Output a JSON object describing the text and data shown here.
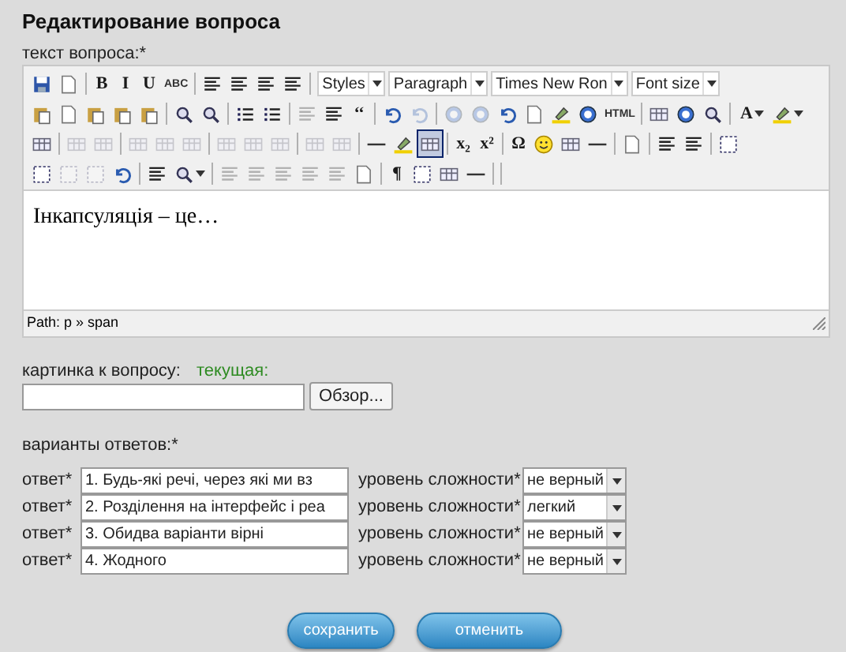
{
  "heading": "Редактирование вопроса",
  "question_label": "текст вопроса:*",
  "toolbar_rows": [
    [
      {
        "kind": "button",
        "disabled": false,
        "active": false
      },
      {
        "kind": "button",
        "disabled": false,
        "active": false
      },
      {
        "kind": "separator"
      },
      {
        "kind": "button",
        "label": "B",
        "disabled": false,
        "active": false
      },
      {
        "kind": "button",
        "label": "I",
        "disabled": false,
        "active": false
      },
      {
        "kind": "button",
        "label": "U",
        "disabled": false,
        "active": false
      },
      {
        "kind": "button",
        "label": "ABC",
        "disabled": false,
        "active": false
      },
      {
        "kind": "separator"
      },
      {
        "kind": "button",
        "disabled": false,
        "active": false
      },
      {
        "kind": "button",
        "disabled": false,
        "active": false
      },
      {
        "kind": "button",
        "disabled": false,
        "active": false
      },
      {
        "kind": "button",
        "disabled": false,
        "active": false
      },
      {
        "kind": "separator"
      },
      {
        "kind": "select",
        "value": "Styles"
      },
      {
        "kind": "select",
        "value": "Paragraph"
      },
      {
        "kind": "select",
        "value": "Times New Ron"
      },
      {
        "kind": "select",
        "value": "Font size"
      }
    ],
    [
      {
        "kind": "button",
        "disabled": false,
        "active": false
      },
      {
        "kind": "button",
        "disabled": false,
        "active": false
      },
      {
        "kind": "button",
        "disabled": false,
        "active": false
      },
      {
        "kind": "button",
        "disabled": false,
        "active": false
      },
      {
        "kind": "button",
        "disabled": false,
        "active": false
      },
      {
        "kind": "separator"
      },
      {
        "kind": "button",
        "disabled": false,
        "active": false
      },
      {
        "kind": "button",
        "disabled": false,
        "active": false
      },
      {
        "kind": "separator"
      },
      {
        "kind": "button",
        "disabled": false,
        "active": false
      },
      {
        "kind": "button",
        "disabled": false,
        "active": false
      },
      {
        "kind": "separator"
      },
      {
        "kind": "button",
        "disabled": true,
        "active": false
      },
      {
        "kind": "button",
        "disabled": false,
        "active": false
      },
      {
        "kind": "button",
        "label": "‘‘",
        "disabled": false,
        "active": false
      },
      {
        "kind": "separator"
      },
      {
        "kind": "button",
        "disabled": false,
        "active": false
      },
      {
        "kind": "button",
        "disabled": true,
        "active": false
      },
      {
        "kind": "separator"
      },
      {
        "kind": "button",
        "disabled": true,
        "active": false
      },
      {
        "kind": "button",
        "disabled": true,
        "active": false
      },
      {
        "kind": "button",
        "disabled": false,
        "active": false
      },
      {
        "kind": "button",
        "disabled": false,
        "active": false
      },
      {
        "kind": "button",
        "disabled": false,
        "active": false
      },
      {
        "kind": "button",
        "disabled": false,
        "active": false
      },
      {
        "kind": "button",
        "label": "HTML",
        "disabled": false,
        "active": false
      },
      {
        "kind": "separator"
      },
      {
        "kind": "button",
        "disabled": false,
        "active": false
      },
      {
        "kind": "button",
        "disabled": false,
        "active": false
      },
      {
        "kind": "button",
        "disabled": false,
        "active": false
      },
      {
        "kind": "separator"
      },
      {
        "kind": "split",
        "label": "A",
        "disabled": false,
        "active": false
      },
      {
        "kind": "split",
        "disabled": false,
        "active": false
      }
    ],
    [
      {
        "kind": "button",
        "disabled": false,
        "active": false
      },
      {
        "kind": "separator"
      },
      {
        "kind": "button",
        "disabled": true,
        "active": false
      },
      {
        "kind": "button",
        "disabled": true,
        "active": false
      },
      {
        "kind": "separator"
      },
      {
        "kind": "button",
        "disabled": true,
        "active": false
      },
      {
        "kind": "button",
        "disabled": true,
        "active": false
      },
      {
        "kind": "button",
        "disabled": true,
        "active": false
      },
      {
        "kind": "separator"
      },
      {
        "kind": "button",
        "disabled": true,
        "active": false
      },
      {
        "kind": "button",
        "disabled": true,
        "active": false
      },
      {
        "kind": "button",
        "disabled": true,
        "active": false
      },
      {
        "kind": "separator"
      },
      {
        "kind": "button",
        "disabled": true,
        "active": false
      },
      {
        "kind": "button",
        "disabled": true,
        "active": false
      },
      {
        "kind": "separator"
      },
      {
        "kind": "button",
        "disabled": false,
        "active": false
      },
      {
        "kind": "button",
        "disabled": false,
        "active": false
      },
      {
        "kind": "button",
        "disabled": false,
        "active": true
      },
      {
        "kind": "separator"
      },
      {
        "kind": "button",
        "label": "x₂",
        "disabled": false,
        "active": false
      },
      {
        "kind": "button",
        "label": "x²",
        "disabled": false,
        "active": false
      },
      {
        "kind": "separator"
      },
      {
        "kind": "button",
        "label": "Ω",
        "disabled": false,
        "active": false
      },
      {
        "kind": "button",
        "disabled": false,
        "active": false
      },
      {
        "kind": "button",
        "disabled": false,
        "active": false
      },
      {
        "kind": "button",
        "disabled": false,
        "active": false
      },
      {
        "kind": "separator"
      },
      {
        "kind": "button",
        "disabled": false,
        "active": false
      },
      {
        "kind": "separator"
      },
      {
        "kind": "button",
        "disabled": false,
        "active": false
      },
      {
        "kind": "button",
        "disabled": false,
        "active": false
      },
      {
        "kind": "separator"
      },
      {
        "kind": "button",
        "disabled": false,
        "active": false
      }
    ],
    [
      {
        "kind": "button",
        "disabled": false,
        "active": false
      },
      {
        "kind": "button",
        "disabled": true,
        "active": false
      },
      {
        "kind": "button",
        "disabled": true,
        "active": false
      },
      {
        "kind": "button",
        "disabled": false,
        "active": false
      },
      {
        "kind": "separator"
      },
      {
        "kind": "button",
        "disabled": false,
        "active": false
      },
      {
        "kind": "split",
        "disabled": false,
        "active": false
      },
      {
        "kind": "separator"
      },
      {
        "kind": "button",
        "disabled": true,
        "active": false
      },
      {
        "kind": "button",
        "disabled": true,
        "active": false
      },
      {
        "kind": "button",
        "disabled": true,
        "active": false
      },
      {
        "kind": "button",
        "disabled": true,
        "active": false
      },
      {
        "kind": "button",
        "disabled": true,
        "active": false
      },
      {
        "kind": "button",
        "disabled": false,
        "active": false
      },
      {
        "kind": "separator"
      },
      {
        "kind": "button",
        "label": "¶",
        "disabled": false,
        "active": false
      },
      {
        "kind": "button",
        "disabled": false,
        "active": false
      },
      {
        "kind": "button",
        "disabled": false,
        "active": false
      },
      {
        "kind": "button",
        "disabled": false,
        "active": false
      },
      {
        "kind": "separator"
      },
      {
        "kind": "separator"
      }
    ]
  ],
  "editor_text": "Інкапсуляція – це…",
  "status_path": "Path: p » span",
  "picture_label": "картинка к вопросу:",
  "picture_current": "текущая:",
  "browse_button": "Обзор...",
  "answers_label": "варианты ответов:*",
  "answers": [
    {
      "label": "ответ*",
      "value": "1. Будь-які речі, через які ми вз",
      "difficulty_label": "уровень сложности*",
      "difficulty": "не верный"
    },
    {
      "label": "ответ*",
      "value": "2. Розділення на інтерфейс і реа",
      "difficulty_label": "уровень сложности*",
      "difficulty": "легкий"
    },
    {
      "label": "ответ*",
      "value": "3. Обидва варіанти вірні",
      "difficulty_label": "уровень сложности*",
      "difficulty": "не верный"
    },
    {
      "label": "ответ*",
      "value": "4. Жодного",
      "difficulty_label": "уровень сложности*",
      "difficulty": "не верный"
    }
  ],
  "buttons": [
    {
      "label": "сохранить"
    },
    {
      "label": "отменить"
    }
  ]
}
